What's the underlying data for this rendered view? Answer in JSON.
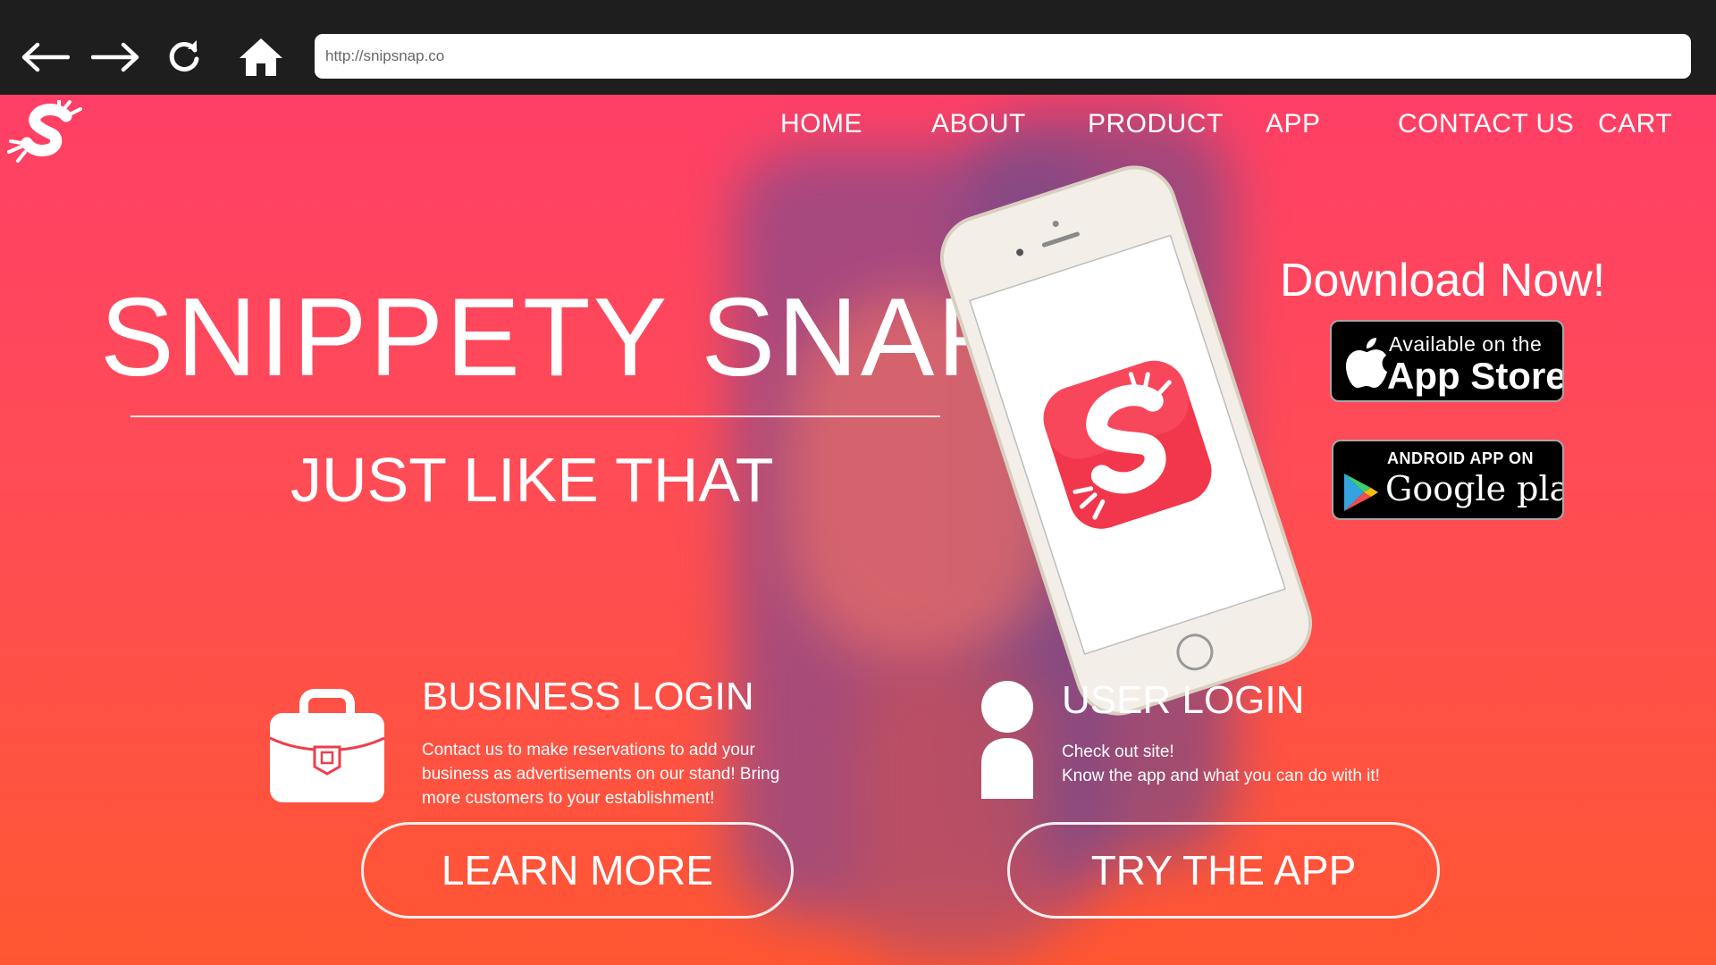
{
  "browser": {
    "url": "http://snipsnap.co",
    "back_icon": "arrow-left-icon",
    "forward_icon": "arrow-right-icon",
    "reload_icon": "reload-icon",
    "home_icon": "home-icon"
  },
  "site": {
    "logo_icon": "snippety-snap-logo",
    "nav": [
      "HOME",
      "ABOUT",
      "PRODUCT",
      "APP",
      "CONTACT US",
      "CART"
    ],
    "hero": {
      "title": "SNIPPETY SNAP",
      "subtitle": "JUST LIKE THAT"
    },
    "download": {
      "title": "Download Now!",
      "appstore": {
        "small": "Available on the",
        "big": "App Store"
      },
      "googleplay": {
        "small": "ANDROID APP ON",
        "big": "Google play"
      }
    },
    "business": {
      "title": "BUSINESS LOGIN",
      "text": "Contact us to make reservations to add your business as advertisements on our stand! Bring more customers to your establishment!",
      "button": "LEARN MORE",
      "icon": "briefcase-icon"
    },
    "user": {
      "title": "USER LOGIN",
      "line1": "Check out site!",
      "line2": "Know the app and what you can do with it!",
      "button": "TRY THE APP",
      "icon": "user-icon"
    }
  },
  "colors": {
    "chrome_bg": "#1e1e1e",
    "gradient_top": "#ff3f66",
    "gradient_bottom": "#ff5632",
    "accent": "#ee3e4c"
  }
}
